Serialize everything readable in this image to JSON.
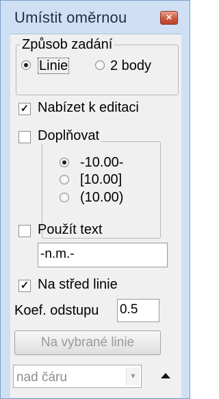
{
  "window": {
    "title": "Umístit oměrnou",
    "close_glyph": "×"
  },
  "entry_mode": {
    "label": "Způsob zadání",
    "options": [
      {
        "label": "Linie",
        "selected": true
      },
      {
        "label": "2 body",
        "selected": false
      }
    ]
  },
  "offer_edit": {
    "label": "Nabízet k editaci",
    "checked": true
  },
  "padding": {
    "label": "Doplňovat",
    "checked": false,
    "options": [
      {
        "label": "-10.00-",
        "selected": true
      },
      {
        "label": "[10.00]",
        "selected": false
      },
      {
        "label": "(10.00)",
        "selected": false
      }
    ]
  },
  "use_text": {
    "label": "Použít text",
    "checked": false,
    "value": "-n.m.-"
  },
  "center_line": {
    "label": "Na střed linie",
    "checked": true
  },
  "offset_coef": {
    "label": "Koef. odstupu",
    "value": "0.5"
  },
  "apply_button": {
    "label": "Na vybrané linie"
  },
  "placement": {
    "value": "nad čáru"
  },
  "icons": {
    "close": "close-icon",
    "check": "checkmark-icon",
    "dropdown": "chevron-down-icon",
    "collapse": "triangle-up-icon"
  }
}
